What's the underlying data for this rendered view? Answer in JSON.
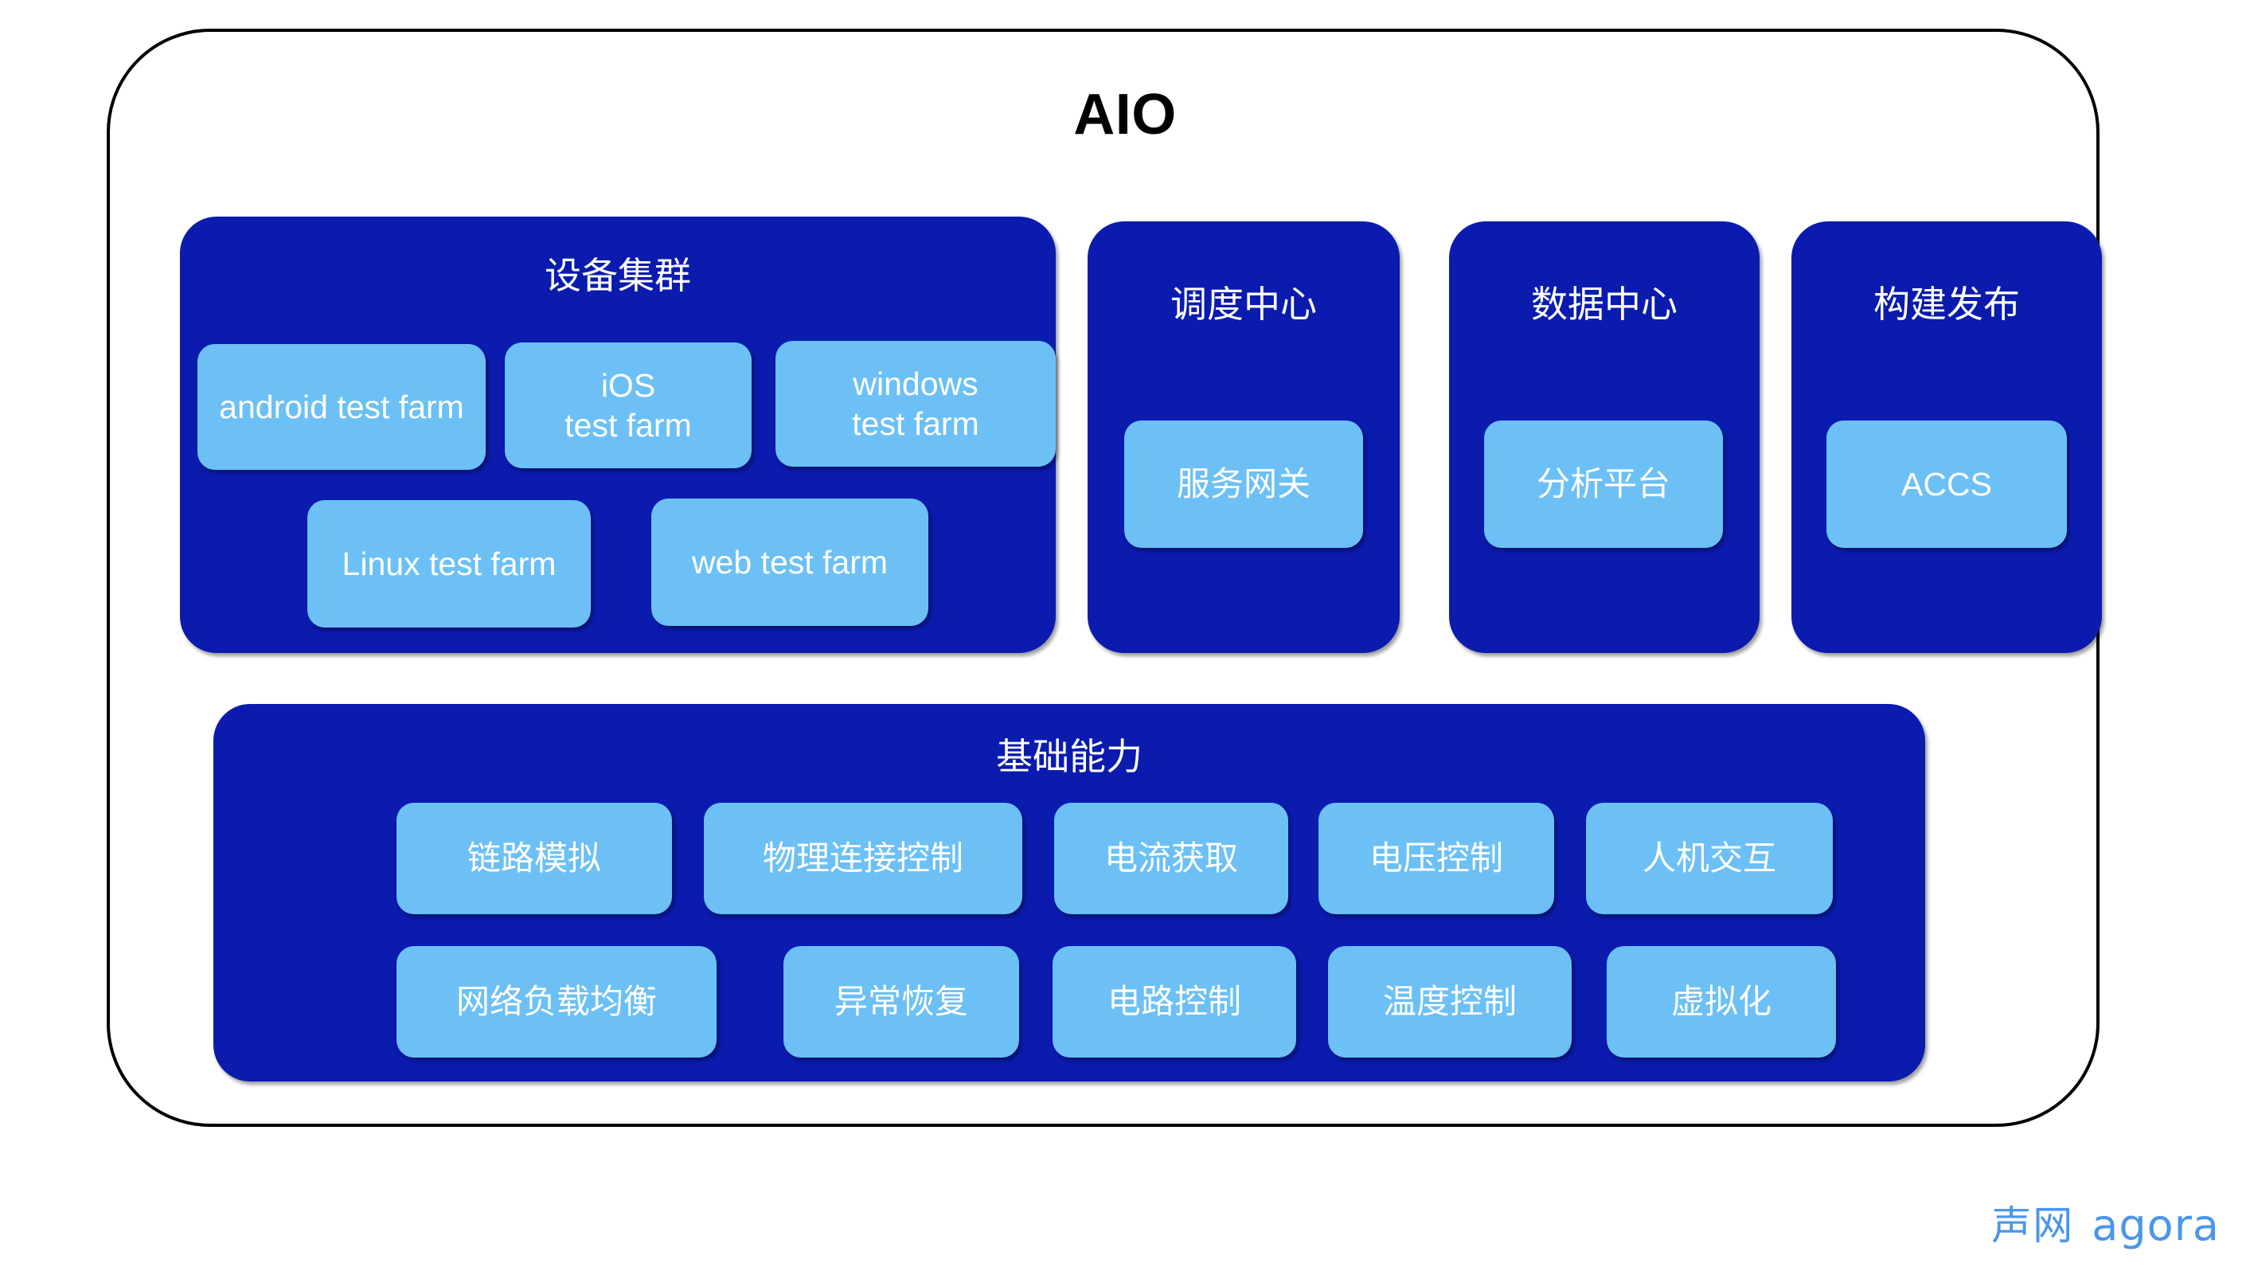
{
  "title": "AIO",
  "colors": {
    "panel_blue": "#0A1BAE",
    "card_blue": "#6CC0F5",
    "frame_stroke": "#000000",
    "logo_blue": "#4A96EB",
    "text_white": "#FFFFFF"
  },
  "groups": [
    {
      "key": "device-cluster",
      "title": "设备集群",
      "cards": [
        {
          "label": "android test farm",
          "lang": "en"
        },
        {
          "label": "iOS\ntest farm",
          "lang": "en"
        },
        {
          "label": "windows\ntest farm",
          "lang": "en"
        },
        {
          "label": "Linux test farm",
          "lang": "en"
        },
        {
          "label": "web test farm",
          "lang": "en"
        }
      ]
    },
    {
      "key": "scheduling-center",
      "title": "调度中心",
      "cards": [
        {
          "label": "服务网关",
          "lang": "cn"
        }
      ]
    },
    {
      "key": "data-center",
      "title": "数据中心",
      "cards": [
        {
          "label": "分析平台",
          "lang": "cn"
        }
      ]
    },
    {
      "key": "build-release",
      "title": "构建发布",
      "cards": [
        {
          "label": "ACCS",
          "lang": "en"
        }
      ]
    },
    {
      "key": "basic-capability",
      "title": "基础能力",
      "cards": [
        {
          "label": "链路模拟",
          "lang": "cn"
        },
        {
          "label": "物理连接控制",
          "lang": "cn"
        },
        {
          "label": "电流获取",
          "lang": "cn"
        },
        {
          "label": "电压控制",
          "lang": "cn"
        },
        {
          "label": "人机交互",
          "lang": "cn"
        },
        {
          "label": "网络负载均衡",
          "lang": "cn"
        },
        {
          "label": "异常恢复",
          "lang": "cn"
        },
        {
          "label": "电路控制",
          "lang": "cn"
        },
        {
          "label": "温度控制",
          "lang": "cn"
        },
        {
          "label": "虚拟化",
          "lang": "cn"
        }
      ]
    }
  ],
  "logo": {
    "cn": "声网",
    "en": "agora"
  }
}
